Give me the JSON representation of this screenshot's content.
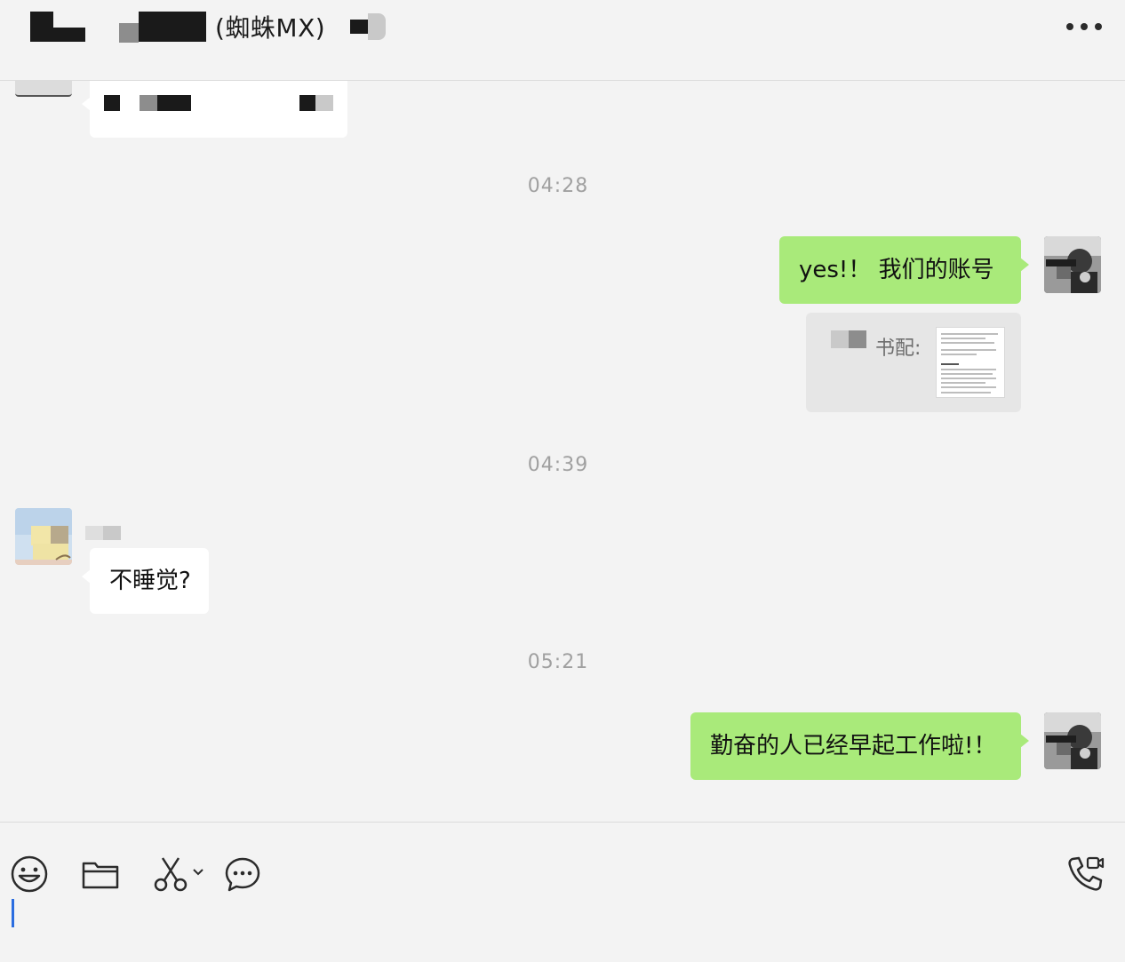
{
  "header": {
    "title_suffix": "(蜘蛛MX)",
    "more_icon": "more-horizontal-icon"
  },
  "messages": {
    "timestamps": [
      "04:28",
      "04:39",
      "05:21"
    ],
    "msg1": {
      "text": "yes!！ 我们的账号",
      "direction": "outgoing"
    },
    "quote": {
      "text": "书配:"
    },
    "msg2": {
      "text": "不睡觉?",
      "direction": "incoming"
    },
    "msg3": {
      "text": "勤奋的人已经早起工作啦!！",
      "direction": "outgoing"
    }
  },
  "toolbar": {
    "icons": [
      "emoji-icon",
      "folder-icon",
      "scissors-icon",
      "chat-bubble-icon",
      "voice-video-call-icon"
    ]
  },
  "colors": {
    "outgoing_bubble": "#a9ea7a",
    "incoming_bubble": "#ffffff",
    "background": "#f3f3f3",
    "caret": "#2b6de0"
  }
}
